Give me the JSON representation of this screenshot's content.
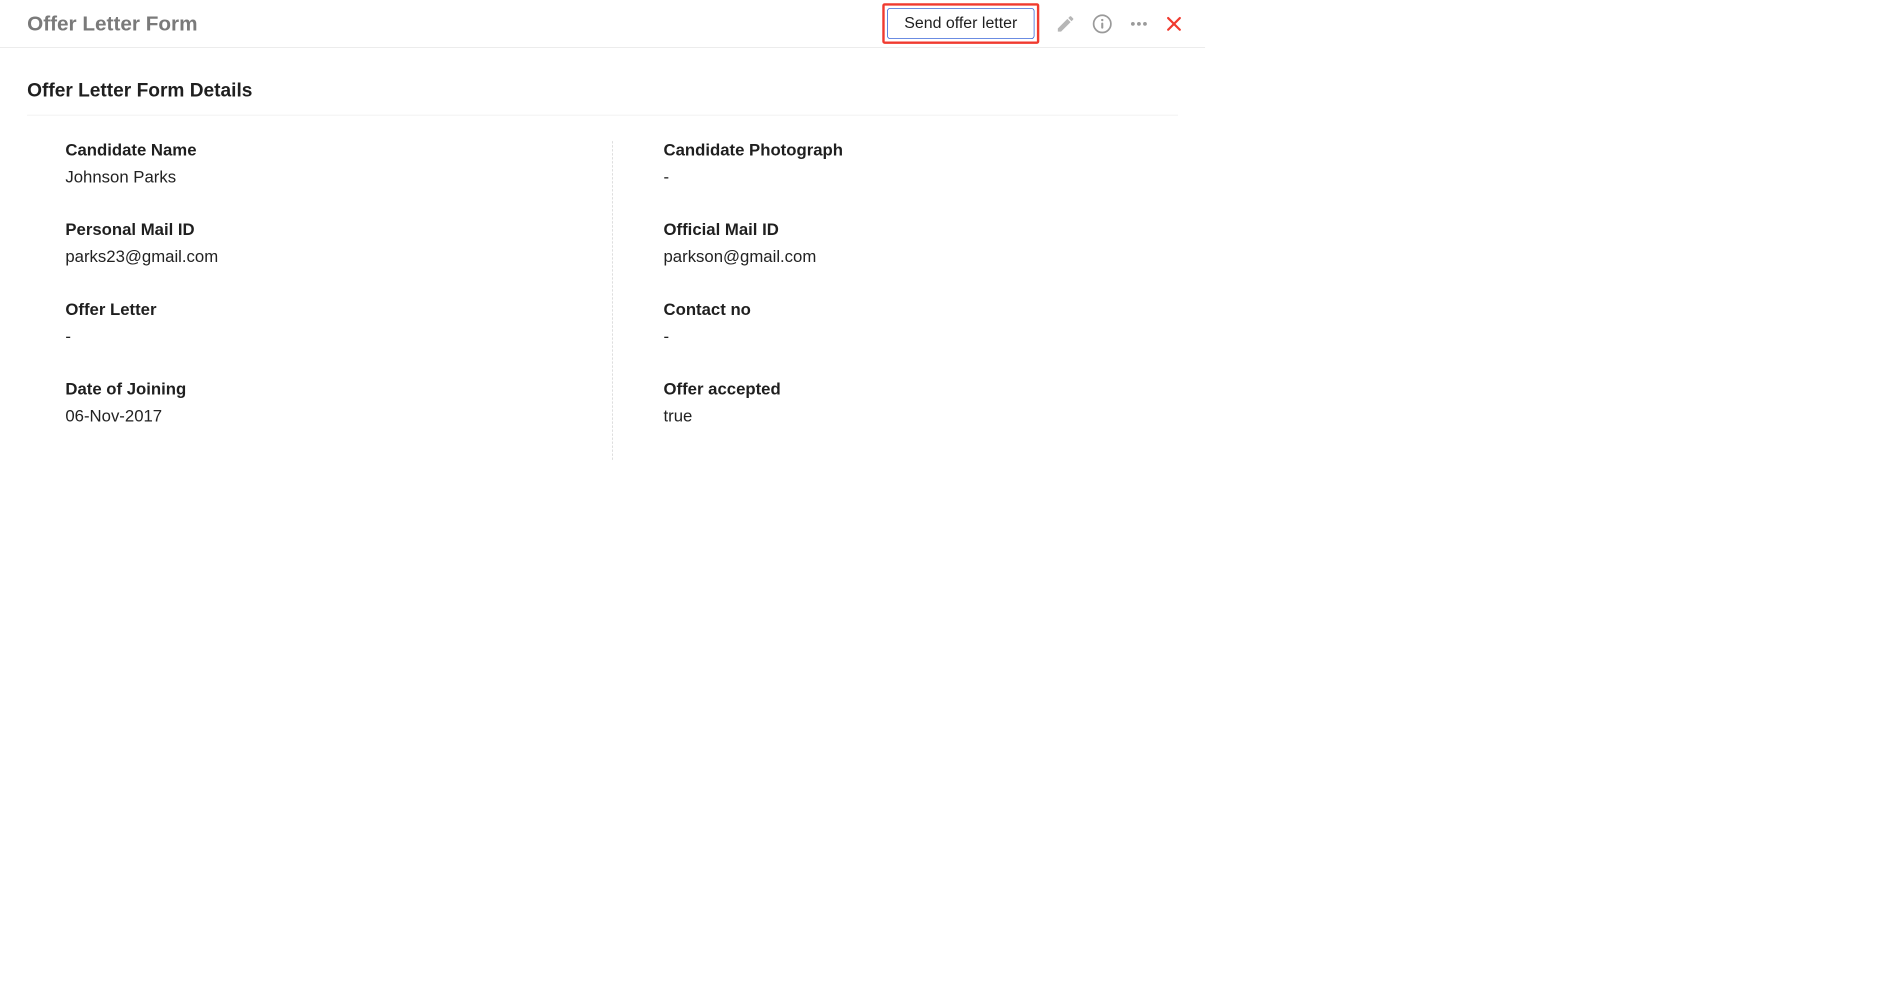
{
  "header": {
    "title": "Offer Letter Form",
    "send_button_label": "Send offer letter"
  },
  "section": {
    "title": "Offer Letter Form Details"
  },
  "fields": {
    "left": [
      {
        "label": "Candidate Name",
        "value": "Johnson Parks"
      },
      {
        "label": "Personal Mail ID",
        "value": "parks23@gmail.com"
      },
      {
        "label": "Offer Letter",
        "value": "-"
      },
      {
        "label": "Date of Joining",
        "value": "06-Nov-2017"
      }
    ],
    "right": [
      {
        "label": "Candidate Photograph",
        "value": "-"
      },
      {
        "label": "Official Mail ID",
        "value": "parkson@gmail.com"
      },
      {
        "label": "Contact no",
        "value": "-"
      },
      {
        "label": "Offer accepted",
        "value": "true"
      }
    ]
  }
}
